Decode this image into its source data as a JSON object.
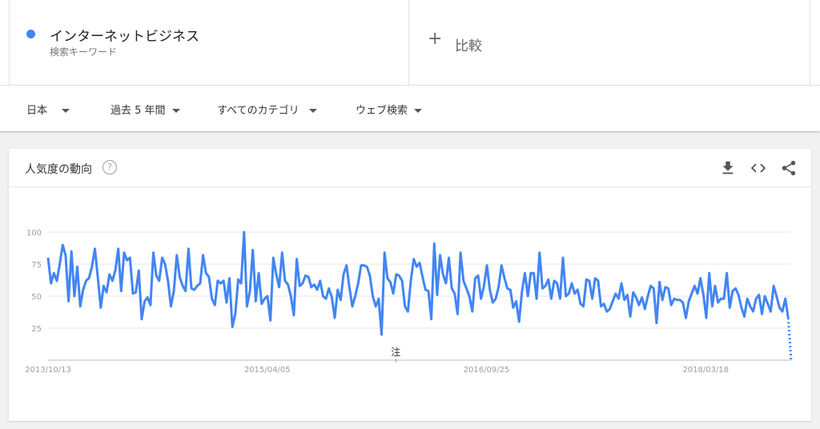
{
  "term": {
    "name": "インターネットビジネス",
    "type": "検索キーワード",
    "color": "#4285f4"
  },
  "compare": {
    "plus": "+",
    "label": "比較"
  },
  "filters": {
    "region": "日本",
    "period": "過去 5 年間",
    "category": "すべてのカテゴリ",
    "property": "ウェブ検索"
  },
  "card": {
    "title": "人気度の動向",
    "help": "?",
    "icons": [
      "download-icon",
      "embed-icon",
      "share-icon"
    ]
  },
  "chart_data": {
    "type": "line",
    "title": "",
    "xlabel": "",
    "ylabel": "",
    "ylim": [
      0,
      100
    ],
    "yticks": [
      25,
      50,
      75,
      100
    ],
    "x_tick_labels": [
      "2013/10/13",
      "2015/04/05",
      "2016/09/25",
      "2018/03/18"
    ],
    "annotation": "注",
    "series": [
      {
        "color": "#4285f4",
        "values": [
          80,
          60,
          68,
          62,
          75,
          90,
          82,
          46,
          85,
          50,
          73,
          42,
          55,
          62,
          64,
          73,
          87,
          65,
          41,
          58,
          53,
          67,
          62,
          70,
          87,
          54,
          84,
          78,
          80,
          52,
          53,
          70,
          32,
          46,
          49,
          43,
          84,
          66,
          62,
          80,
          75,
          62,
          42,
          54,
          82,
          65,
          58,
          54,
          87,
          56,
          55,
          58,
          60,
          82,
          68,
          65,
          48,
          43,
          62,
          60,
          62,
          45,
          64,
          26,
          36,
          63,
          60,
          100,
          42,
          54,
          86,
          46,
          68,
          44,
          48,
          50,
          31,
          80,
          67,
          57,
          84,
          62,
          59,
          50,
          35,
          79,
          58,
          60,
          66,
          65,
          57,
          59,
          55,
          62,
          50,
          48,
          56,
          49,
          33,
          55,
          47,
          67,
          74,
          57,
          42,
          50,
          60,
          74,
          74,
          73,
          66,
          50,
          42,
          48,
          20,
          84,
          64,
          61,
          52,
          67,
          66,
          62,
          42,
          38,
          62,
          79,
          73,
          76,
          65,
          55,
          54,
          32,
          91,
          51,
          82,
          67,
          60,
          80,
          56,
          52,
          36,
          84,
          62,
          56,
          50,
          38,
          64,
          66,
          48,
          58,
          74,
          55,
          45,
          48,
          57,
          74,
          64,
          56,
          55,
          41,
          46,
          30,
          54,
          68,
          50,
          68,
          68,
          48,
          84,
          56,
          58,
          63,
          48,
          62,
          60,
          48,
          80,
          50,
          52,
          60,
          52,
          55,
          44,
          42,
          63,
          62,
          48,
          64,
          62,
          42,
          44,
          38,
          40,
          46,
          52,
          48,
          60,
          47,
          51,
          34,
          53,
          49,
          43,
          49,
          40,
          50,
          58,
          56,
          29,
          61,
          47,
          57,
          56,
          43,
          48,
          47,
          47,
          45,
          33,
          46,
          52,
          58,
          52,
          64,
          51,
          33,
          68,
          42,
          58,
          45,
          48,
          48,
          68,
          41,
          54,
          56,
          51,
          41,
          34,
          48,
          42,
          38,
          48,
          51,
          36,
          50,
          44,
          38,
          58,
          50,
          41,
          38,
          48,
          33
        ]
      }
    ],
    "partial_last_value": 0
  }
}
